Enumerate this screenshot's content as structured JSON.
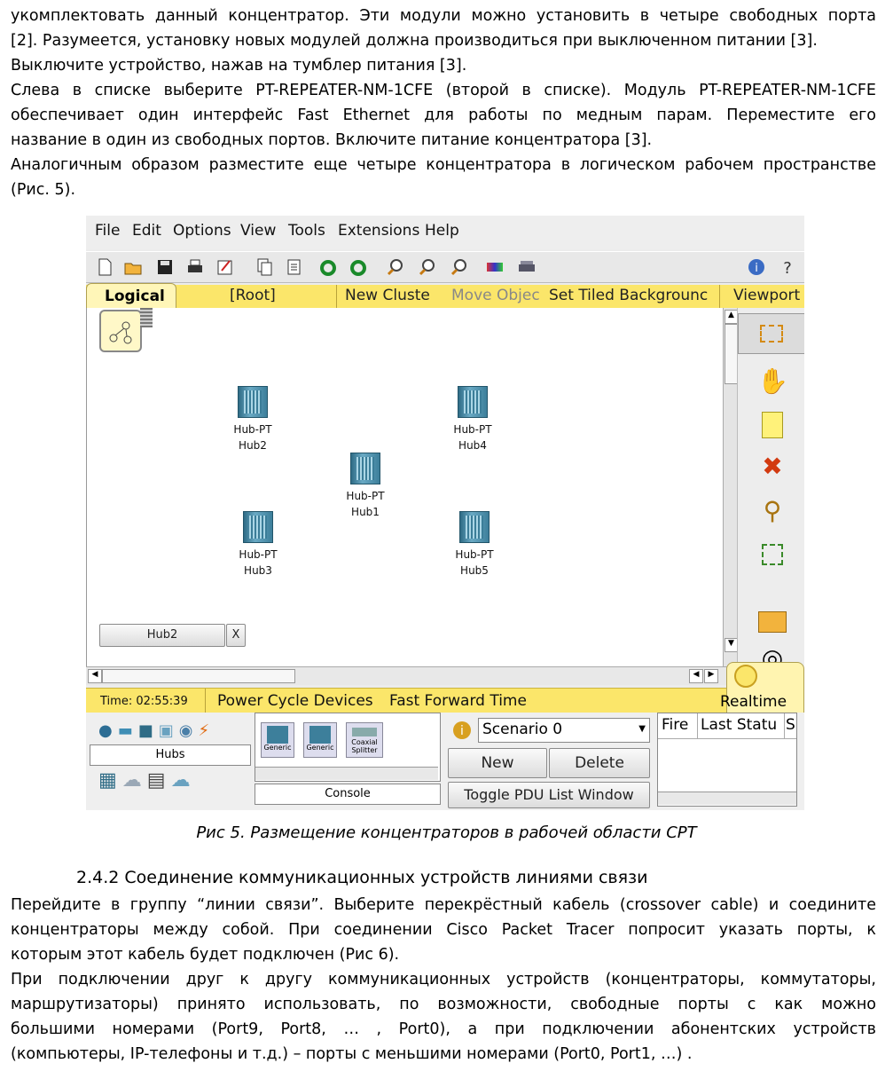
{
  "text": {
    "p1_l1": "укомплектовать данный концентратор. Эти модули можно установить в четыре свободных порта",
    "p1_l2": "[2]. Разумеется, установку новых модулей должна производиться при выключенном питании [3].",
    "p2": "Выключите устройство, нажав на тумблер питания [3].",
    "p3_l1": "Слева в списке выберите PT-REPEATER-NM-1CFE  (второй в списке). Модуль PT-REPEATER-NM-1CFE",
    "p3_l2": "обеспечивает один интерфейс Fast Ethernet для работы по медным парам. Переместите его",
    "p3_l3": "название в один из свободных портов. Включите питание концентратора [3].",
    "p4_l1": "Аналогичным образом разместите еще четыре концентратора в логическом рабочем пространстве",
    "p4_l2": "(Рис. 5).",
    "caption": "Рис 5. Размещение концентраторов в рабочей области CPT",
    "heading": "2.4.2 Соединение коммуникационных устройств линиями связи",
    "p5_l1": "Перейдите в группу “линии связи”. Выберите перекрёстный кабель (crossover cable) и соедините",
    "p5_l2": "концентраторы между собой. При соединении Cisco Packet Tracer попросит указать порты, к",
    "p5_l3": "которым этот кабель будет подключен (Рис 6).",
    "p6_l1": "При подключении друг к другу коммуникационных устройств (концентраторы, коммутаторы,",
    "p6_l2": "маршрутизаторы) принято использовать, по возможности, свободные порты с как можно",
    "p6_l3": "большими номерами (Port9, Port8, … , Port0), а при подключении абонентских устройств",
    "p6_l4": "(компьютеры, IP-телефоны и т.д.) – порты с меньшими номерами (Port0, Port1, …) ."
  },
  "app": {
    "menu": [
      "File",
      "Edit",
      "Options",
      "View",
      "Tools",
      "Extensions",
      "Help"
    ],
    "tabs": {
      "logical": "Logical",
      "root": "[Root]",
      "new_cluster": "New Cluste",
      "move_object": "Move Objec",
      "set_tiled": "Set Tiled Backgrounc",
      "viewport": "Viewport"
    },
    "devices": [
      {
        "model": "Hub-PT",
        "name": "Hub2"
      },
      {
        "model": "Hub-PT",
        "name": "Hub4"
      },
      {
        "model": "Hub-PT",
        "name": "Hub1"
      },
      {
        "model": "Hub-PT",
        "name": "Hub3"
      },
      {
        "model": "Hub-PT",
        "name": "Hub5"
      }
    ],
    "popup_label": "Hub2",
    "popup_close": "X",
    "status": {
      "time": "Time: 02:55:39",
      "power_cycle": "Power Cycle Devices",
      "fast_forward": "Fast Forward Time",
      "realtime": "Realtime"
    },
    "bottom": {
      "category": "Hubs",
      "device_labels": [
        "Generic",
        "Generic",
        "Coaxial Splitter"
      ],
      "console": "Console",
      "scenario": "Scenario 0",
      "new": "New",
      "delete": "Delete",
      "toggle_pdu": "Toggle PDU List Window",
      "columns": [
        "Fire",
        "Last Statu",
        "S"
      ]
    },
    "colors": {
      "accent_yellow": "#fbe66a",
      "hub_blue": "#3d7f9b"
    },
    "icons": [
      "new-file-icon",
      "open-folder-icon",
      "save-icon",
      "print-icon",
      "activity-wizard-icon",
      "copy-icon",
      "paste-icon",
      "undo-icon",
      "redo-icon",
      "zoom-in-icon",
      "zoom-reset-icon",
      "zoom-out-icon",
      "palette-icon",
      "custom-device-icon",
      "info-icon",
      "help-icon"
    ]
  }
}
